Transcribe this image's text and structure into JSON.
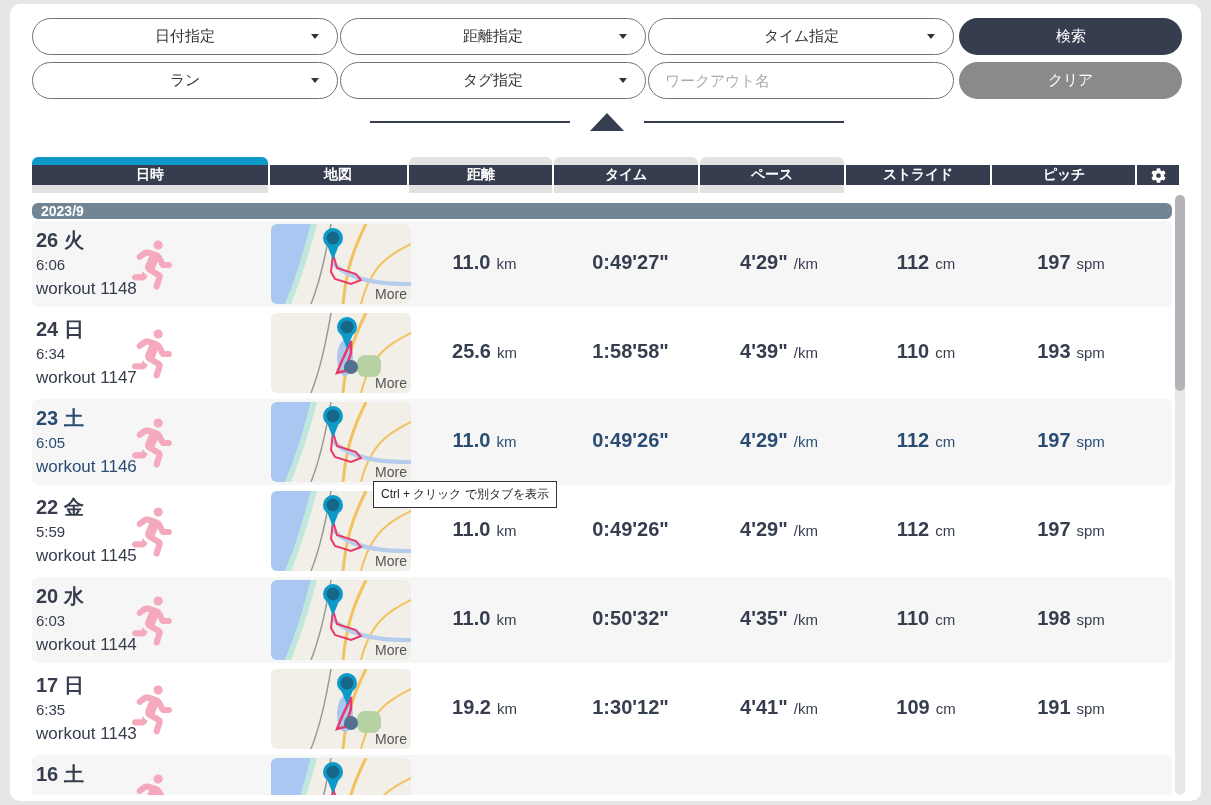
{
  "filters": [
    {
      "kind": "select",
      "value": "日付指定"
    },
    {
      "kind": "select",
      "value": "距離指定"
    },
    {
      "kind": "select",
      "value": "タイム指定"
    },
    {
      "kind": "primary",
      "value": "検索"
    },
    {
      "kind": "select",
      "value": "ラン"
    },
    {
      "kind": "select",
      "value": "タグ指定"
    },
    {
      "kind": "input",
      "placeholder": "ワークアウト名"
    },
    {
      "kind": "secondary",
      "value": "クリア"
    }
  ],
  "columns": [
    {
      "label": "日時",
      "selected": true,
      "sortable": true
    },
    {
      "label": "地図",
      "selected": false,
      "sortable": false
    },
    {
      "label": "距離",
      "selected": false,
      "sortable": true
    },
    {
      "label": "タイム",
      "selected": false,
      "sortable": true
    },
    {
      "label": "ペース",
      "selected": false,
      "sortable": true
    },
    {
      "label": "ストライド",
      "selected": false,
      "sortable": false
    },
    {
      "label": "ピッチ",
      "selected": false,
      "sortable": false
    }
  ],
  "group": "2023/9",
  "rows": [
    {
      "date": "26 火",
      "time": "6:06",
      "name": "workout 1148",
      "map_link": "More",
      "distance": "11.0",
      "distance_unit": "km",
      "duration": "0:49'27\"",
      "pace": "4'29\"",
      "pace_unit": "/km",
      "stride": "112",
      "stride_unit": "cm",
      "pitch": "197",
      "pitch_unit": "spm",
      "hovered": false
    },
    {
      "date": "24 日",
      "time": "6:34",
      "name": "workout 1147",
      "map_link": "More",
      "distance": "25.6",
      "distance_unit": "km",
      "duration": "1:58'58\"",
      "pace": "4'39\"",
      "pace_unit": "/km",
      "stride": "110",
      "stride_unit": "cm",
      "pitch": "193",
      "pitch_unit": "spm",
      "hovered": false
    },
    {
      "date": "23 土",
      "time": "6:05",
      "name": "workout 1146",
      "map_link": "More",
      "distance": "11.0",
      "distance_unit": "km",
      "duration": "0:49'26\"",
      "pace": "4'29\"",
      "pace_unit": "/km",
      "stride": "112",
      "stride_unit": "cm",
      "pitch": "197",
      "pitch_unit": "spm",
      "hovered": true,
      "tooltip": "Ctrl + クリック で別タブを表示"
    },
    {
      "date": "22 金",
      "time": "5:59",
      "name": "workout 1145",
      "map_link": "More",
      "distance": "11.0",
      "distance_unit": "km",
      "duration": "0:49'26\"",
      "pace": "4'29\"",
      "pace_unit": "/km",
      "stride": "112",
      "stride_unit": "cm",
      "pitch": "197",
      "pitch_unit": "spm",
      "hovered": false
    },
    {
      "date": "20 水",
      "time": "6:03",
      "name": "workout 1144",
      "map_link": "More",
      "distance": "11.0",
      "distance_unit": "km",
      "duration": "0:50'32\"",
      "pace": "4'35\"",
      "pace_unit": "/km",
      "stride": "110",
      "stride_unit": "cm",
      "pitch": "198",
      "pitch_unit": "spm",
      "hovered": false
    },
    {
      "date": "17 日",
      "time": "6:35",
      "name": "workout 1143",
      "map_link": "More",
      "distance": "19.2",
      "distance_unit": "km",
      "duration": "1:30'12\"",
      "pace": "4'41\"",
      "pace_unit": "/km",
      "stride": "109",
      "stride_unit": "cm",
      "pitch": "191",
      "pitch_unit": "spm",
      "hovered": false
    },
    {
      "date": "16 土",
      "hovered": false
    }
  ]
}
